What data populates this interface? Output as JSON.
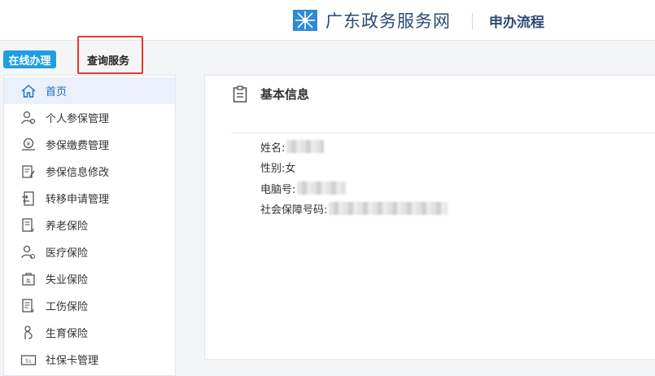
{
  "header": {
    "logo": "snowflake-grid-logo",
    "title": "广东政务服务网",
    "subtitle": "申办流程"
  },
  "tabs": {
    "online": "在线办理",
    "query": "查询服务"
  },
  "sidebar": {
    "items": [
      {
        "label": "首页",
        "icon": "home-icon",
        "active": true
      },
      {
        "label": "个人参保管理",
        "icon": "user-gear-icon",
        "active": false
      },
      {
        "label": "参保缴费管理",
        "icon": "payment-icon",
        "active": false
      },
      {
        "label": "参保信息修改",
        "icon": "edit-doc-icon",
        "active": false
      },
      {
        "label": "转移申请管理",
        "icon": "transfer-icon",
        "active": false
      },
      {
        "label": "养老保险",
        "icon": "pension-doc-icon",
        "active": false
      },
      {
        "label": "医疗保险",
        "icon": "medical-user-icon",
        "active": false
      },
      {
        "label": "失业保险",
        "icon": "unemployment-icon",
        "active": false
      },
      {
        "label": "工伤保险",
        "icon": "injury-doc-icon",
        "active": false
      },
      {
        "label": "生育保险",
        "icon": "maternity-icon",
        "active": false
      },
      {
        "label": "社保卡管理",
        "icon": "si-card-icon",
        "active": false
      }
    ]
  },
  "main": {
    "section_title": "基本信息",
    "fields": {
      "name_label": "姓名:",
      "gender_label": "性别:",
      "gender_value": "女",
      "computer_no_label": "电脑号:",
      "ssn_label": "社会保障号码:"
    }
  },
  "colors": {
    "accent": "#1e9ee3",
    "highlight_border": "#e8382f",
    "brand_text": "#2c4a73",
    "active_item_bg": "#eaf1fb"
  }
}
